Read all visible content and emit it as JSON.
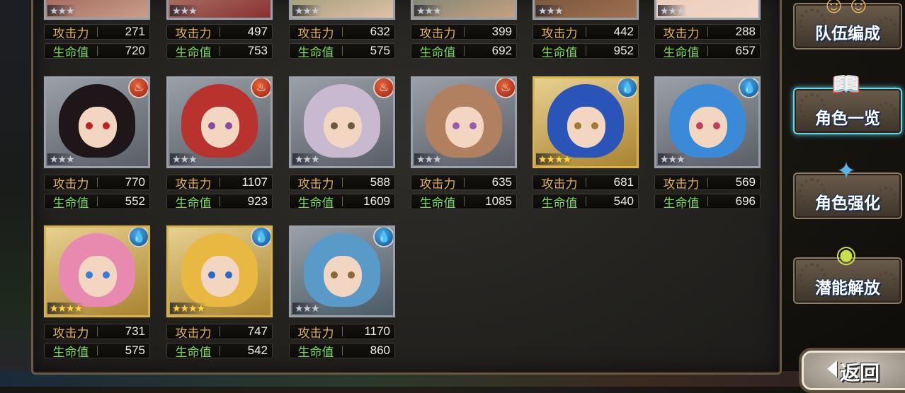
{
  "labels": {
    "atk": "攻击力",
    "hp": "生命值"
  },
  "characters": [
    {
      "atk": "271",
      "hp": "720",
      "stars": "★★★"
    },
    {
      "atk": "497",
      "hp": "753",
      "stars": "★★★"
    },
    {
      "atk": "632",
      "hp": "575",
      "stars": "★★★"
    },
    {
      "atk": "399",
      "hp": "692",
      "stars": "★★★"
    },
    {
      "atk": "442",
      "hp": "952",
      "stars": "★★★"
    },
    {
      "atk": "288",
      "hp": "657",
      "stars": "★★★"
    },
    {
      "atk": "770",
      "hp": "552",
      "stars": "★★★",
      "element": "fire"
    },
    {
      "atk": "1107",
      "hp": "923",
      "stars": "★★★",
      "element": "fire"
    },
    {
      "atk": "588",
      "hp": "1609",
      "stars": "★★★",
      "element": "fire"
    },
    {
      "atk": "635",
      "hp": "1085",
      "stars": "★★★",
      "element": "fire"
    },
    {
      "atk": "681",
      "hp": "540",
      "stars": "★★★★",
      "element": "water"
    },
    {
      "atk": "569",
      "hp": "696",
      "stars": "★★★",
      "element": "water"
    },
    {
      "atk": "731",
      "hp": "575",
      "stars": "★★★★",
      "element": "water"
    },
    {
      "atk": "747",
      "hp": "542",
      "stars": "★★★★",
      "element": "water"
    },
    {
      "atk": "1170",
      "hp": "860",
      "stars": "★★★",
      "element": "water"
    }
  ],
  "sidebar": {
    "team": "队伍编成",
    "roster": "角色一览",
    "enhance": "角色强化",
    "potential": "潜能解放"
  },
  "back": "返回",
  "colors": {
    "atk_label": "#e0b35a",
    "hp_label": "#7ed85a",
    "active_glow": "#6fd8e8"
  }
}
